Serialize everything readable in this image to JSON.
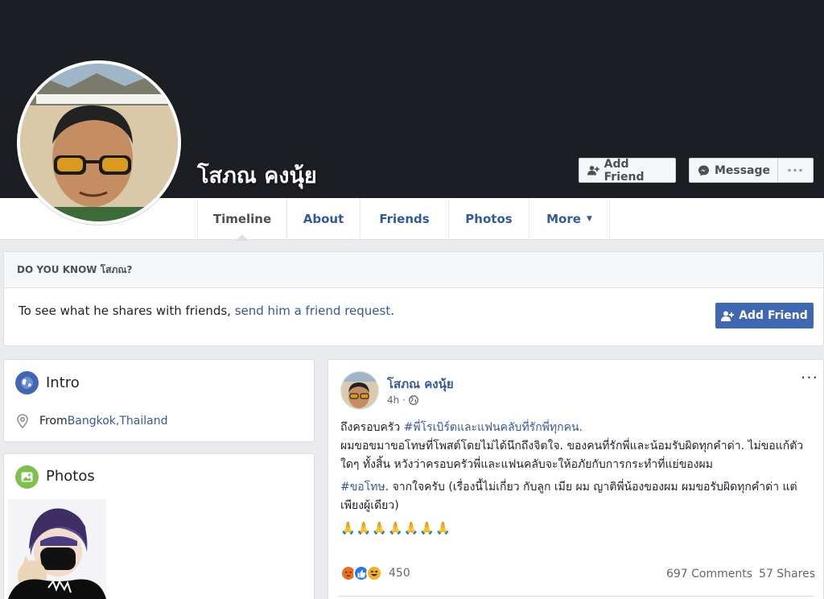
{
  "profile": {
    "name": "โสภณ คงนุ้ย",
    "add_friend_label": "Add Friend",
    "message_label": "Message",
    "more_label": "···"
  },
  "nav": {
    "tabs": [
      {
        "label": "Timeline"
      },
      {
        "label": "About"
      },
      {
        "label": "Friends"
      },
      {
        "label": "Photos"
      },
      {
        "label": "More"
      }
    ]
  },
  "know": {
    "heading": "DO YOU KNOW โสภณ?",
    "text": "To see what he shares with friends, ",
    "link": "send him a friend request",
    "suffix": ".",
    "button_label": "Add Friend"
  },
  "intro": {
    "title": "Intro",
    "from_label": "From ",
    "city": "Bangkok",
    "sep": ", ",
    "country": "Thailand"
  },
  "photos": {
    "title": "Photos"
  },
  "post": {
    "author": "โสภณ คงนุ้ย",
    "time": "4h",
    "more_label": "···",
    "line1_prefix": "ถึงครอบครัว ",
    "line1_hashtag": "#พี่โรเบิร์ตและแฟนคลับที่รักพี่ทุกคน.",
    "line2": "ผมขอขมาขอโทษที่โพสต์โดยไม่ได้นึกถึงจิตใจ. ของคนที่รักพี่และน้อมรับผิดทุกคำด่า. ไม่ขอแก้ตัวใดๆ ทั้งสิ้น หวังว่าครอบครัวพี่และแฟนคลับจะให้อภัยกับการกระทำที่แย่ของผม",
    "line3_hashtag": "#ขอโทษ",
    "line3_rest": ". จากใจครับ (เรื่องนี้ไม่เกี่ยว กับลูก เมีย ผม ญาติพี่น้องของผม ผมขอรับผิดทุกคำด่า แต่เพียงผู้เดียว)",
    "emojis": "🙏🙏🙏🙏🙏🙏🙏",
    "reaction_count": "450",
    "comments": "697 Comments",
    "shares": "57 Shares"
  },
  "colors": {
    "fb_blue": "#4267b2",
    "link": "#365899",
    "cover": "#1c1e24"
  }
}
